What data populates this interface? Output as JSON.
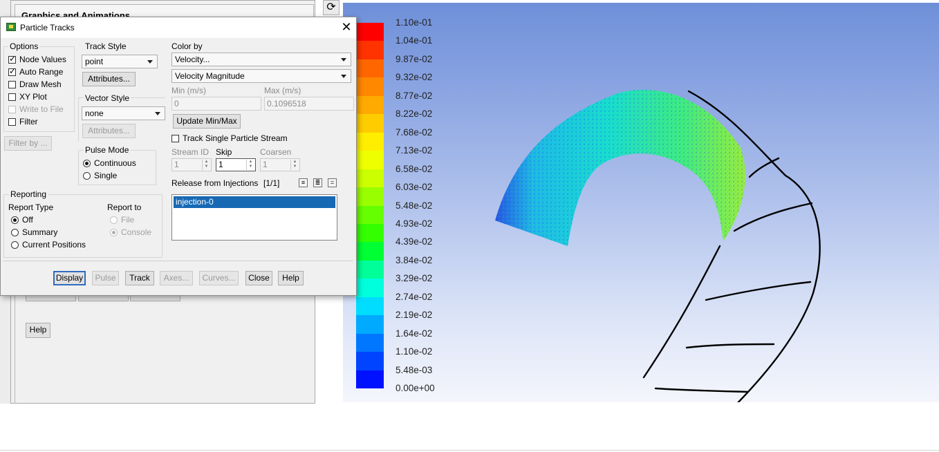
{
  "background_panel": {
    "header_title": "Graphics and Animations",
    "help_label": "Help"
  },
  "dialog": {
    "title": "Particle Tracks",
    "options": {
      "label": "Options",
      "node_values": "Node Values",
      "auto_range": "Auto Range",
      "draw_mesh": "Draw Mesh",
      "xy_plot": "XY Plot",
      "write_to_file": "Write to File",
      "filter": "Filter",
      "filter_by": "Filter by ..."
    },
    "track_style": {
      "label": "Track Style",
      "selected": "point",
      "attributes": "Attributes..."
    },
    "vector_style": {
      "label": "Vector Style",
      "selected": "none",
      "attributes": "Attributes..."
    },
    "pulse_mode": {
      "label": "Pulse Mode",
      "continuous": "Continuous",
      "single": "Single"
    },
    "color_by": {
      "label": "Color by",
      "category": "Velocity...",
      "quantity": "Velocity Magnitude",
      "min_label": "Min (m/s)",
      "max_label": "Max (m/s)",
      "min_value": "0",
      "max_value": "0.1096518",
      "update_button": "Update Min/Max"
    },
    "track_single": "Track Single Particle Stream",
    "stream_id_label": "Stream ID",
    "stream_id_value": "1",
    "skip_label": "Skip",
    "skip_value": "1",
    "coarsen_label": "Coarsen",
    "coarsen_value": "1",
    "release_label": "Release from Injections",
    "release_count": "[1/1]",
    "injections": [
      "injection-0"
    ],
    "reporting": {
      "label": "Reporting",
      "report_type_label": "Report Type",
      "off": "Off",
      "summary": "Summary",
      "current_positions": "Current Positions",
      "report_to_label": "Report to",
      "file": "File",
      "console": "Console"
    },
    "buttons": {
      "display": "Display",
      "pulse": "Pulse",
      "track": "Track",
      "axes": "Axes...",
      "curves": "Curves...",
      "close": "Close",
      "help": "Help"
    }
  },
  "colorbar": {
    "labels": [
      "1.10e-01",
      "1.04e-01",
      "9.87e-02",
      "9.32e-02",
      "8.77e-02",
      "8.22e-02",
      "7.68e-02",
      "7.13e-02",
      "6.58e-02",
      "6.03e-02",
      "5.48e-02",
      "4.93e-02",
      "4.39e-02",
      "3.84e-02",
      "3.29e-02",
      "2.74e-02",
      "2.19e-02",
      "1.64e-02",
      "1.10e-02",
      "5.48e-03",
      "0.00e+00"
    ],
    "colors_top_to_bottom": [
      "#ff0000",
      "#ff3300",
      "#ff6600",
      "#ff8800",
      "#ffaa00",
      "#ffcc00",
      "#ffee00",
      "#eeff00",
      "#ccff00",
      "#99ff00",
      "#66ff00",
      "#33ff00",
      "#00ff33",
      "#00ff99",
      "#00ffdd",
      "#00ddff",
      "#00aaff",
      "#0077ff",
      "#0044ff",
      "#0011ff"
    ]
  },
  "colors": {
    "selection_blue": "#1769b4",
    "dialog_bg": "#f0f0f0"
  },
  "icons": {
    "refresh": "refresh-icon",
    "title": "fluent-app-icon",
    "close": "close-icon"
  }
}
